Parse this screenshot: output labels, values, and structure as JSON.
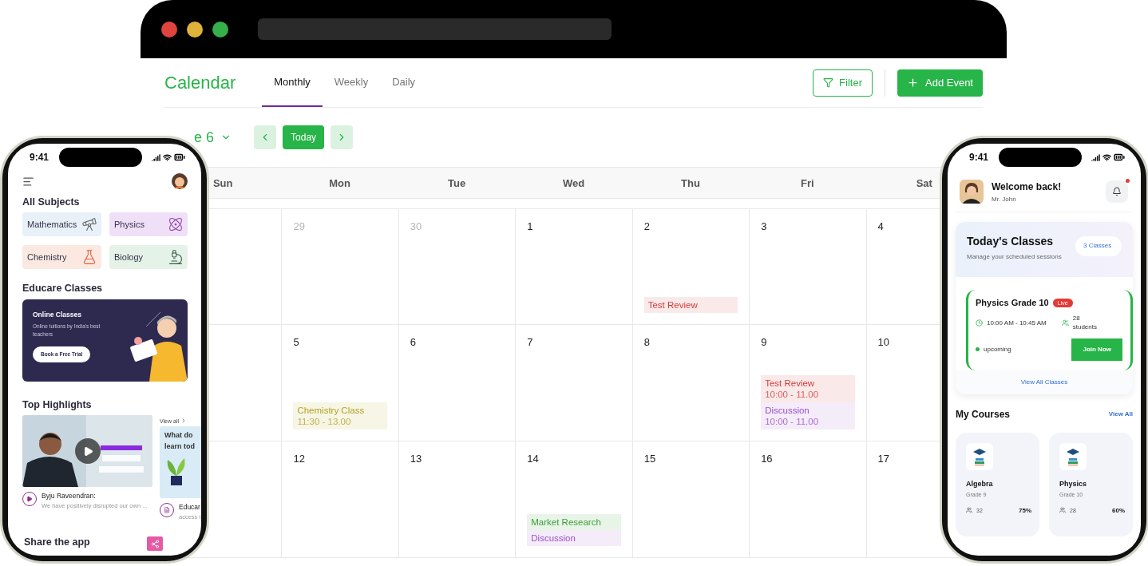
{
  "calendar": {
    "title": "Calendar",
    "tabs": [
      {
        "label": "Monthly",
        "selected": true
      },
      {
        "label": "Weekly",
        "selected": false
      },
      {
        "label": "Daily",
        "selected": false
      }
    ],
    "filter_button": "Filter",
    "add_button": "Add Event",
    "date_label": "e 6",
    "today_button": "Today",
    "weekdays": [
      "Sun",
      "Mon",
      "Tue",
      "Wed",
      "Thu",
      "Fri",
      "Sat"
    ],
    "weeks": [
      {
        "days": [
          {
            "day": "29",
            "muted": true
          },
          {
            "day": "30",
            "muted": true
          },
          {
            "day": "1",
            "muted": false
          },
          {
            "day": "2",
            "muted": false,
            "events": [
              {
                "title": "Test Review",
                "color": "#d63a3a"
              }
            ]
          },
          {
            "day": "3",
            "muted": false
          },
          {
            "day": "4",
            "muted": false
          }
        ]
      },
      {
        "days": [
          {
            "day": "5",
            "muted": false,
            "events": [
              {
                "title": "Chemistry Class",
                "time": "11:30 - 13.00",
                "color": "#b3a21c"
              }
            ]
          },
          {
            "day": "6",
            "muted": false
          },
          {
            "day": "7",
            "muted": false
          },
          {
            "day": "8",
            "muted": false
          },
          {
            "day": "9",
            "muted": false,
            "events": [
              {
                "title": "Test Review",
                "time": "10:00 - 11.00",
                "color": "#d63a3a"
              },
              {
                "title": "Discussion",
                "time": "10:00 - 11.00",
                "color": "#9b4fc7"
              }
            ]
          },
          {
            "day": "10",
            "muted": false
          }
        ]
      },
      {
        "days": [
          {
            "day": "12",
            "muted": false
          },
          {
            "day": "13",
            "muted": false
          },
          {
            "day": "14",
            "muted": false,
            "events": [
              {
                "title": "Market Research",
                "color": "#3a9e36"
              },
              {
                "title": "Discussion",
                "color": "#9b4fc7"
              }
            ]
          },
          {
            "day": "15",
            "muted": false
          },
          {
            "day": "16",
            "muted": false
          },
          {
            "day": "17",
            "muted": false
          }
        ]
      }
    ]
  },
  "left_phone": {
    "time": "9:41",
    "subjects_title": "All Subjects",
    "subjects": [
      {
        "name": "Mathematics",
        "color": "#e8f0f8"
      },
      {
        "name": "Physics",
        "color": "#efdff7"
      },
      {
        "name": "Chemistry",
        "color": "#fbe9e1"
      },
      {
        "name": "Biology",
        "color": "#e5f2e7"
      }
    ],
    "classes_title": "Educare Classes",
    "banner": {
      "title": "Online Classes",
      "text": "Online tuitions by India's best teachers",
      "button": "Book a Free Trial"
    },
    "highlights_title": "Top Highlights",
    "view_all": "View all",
    "highlights": [
      {
        "kind": "video",
        "title": "Byju Raveendran:",
        "text": "We have positively disrupted our own ..."
      },
      {
        "kind": "article",
        "lines": [
          "What do",
          "learn tod"
        ],
        "title": "Educar",
        "text": "access t"
      }
    ],
    "share_title": "Share the app"
  },
  "right_phone": {
    "time": "9:41",
    "greeting": "Welcome back!",
    "user": "Mr. John",
    "unread": true,
    "today": {
      "title": "Today's Classes",
      "subtitle": "Manage your scheduled sessions",
      "count": "3 Classes",
      "class": {
        "name": "Physics Grade 10",
        "badge": "Live",
        "time": "10:00 AM - 10:45 AM",
        "students": "28 students",
        "status": "upcoming",
        "button": "Join Now"
      },
      "link": "View All Classes"
    },
    "courses_title": "My Courses",
    "courses_link": "View All",
    "courses": [
      {
        "name": "Algebra",
        "grade": "Grade 9",
        "students": "32",
        "progress": "75%"
      },
      {
        "name": "Physics",
        "grade": "Grade 10",
        "students": "28",
        "progress": "60%"
      }
    ]
  }
}
